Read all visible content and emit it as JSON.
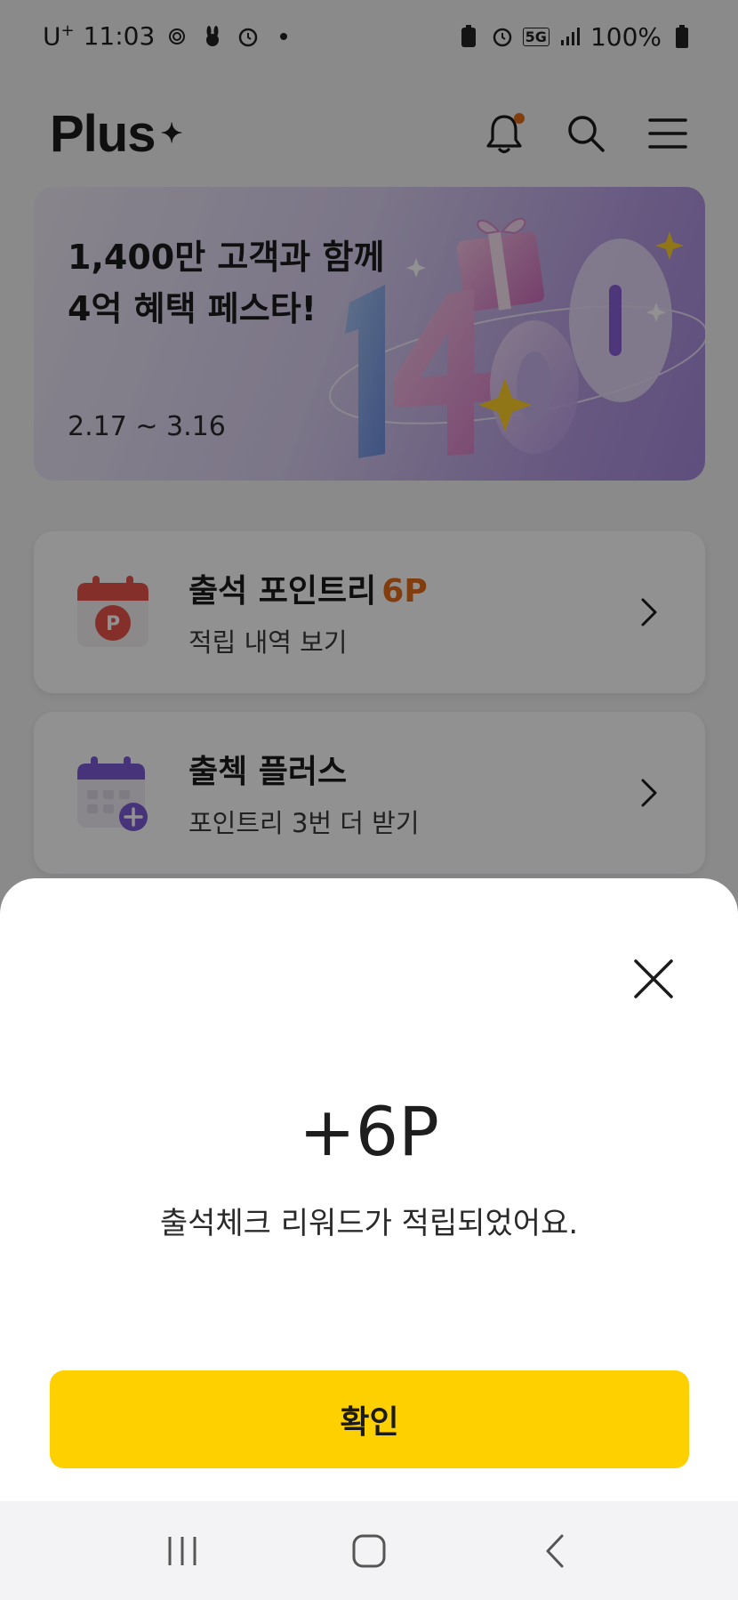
{
  "status_bar": {
    "carrier": "U",
    "carrier_sup": "+",
    "time": "11:03",
    "network": "5G",
    "battery": "100%"
  },
  "header": {
    "logo": "Plus",
    "icons": [
      "bell-icon",
      "search-icon",
      "menu-icon"
    ],
    "notification_dot_color": "#e46c1b"
  },
  "banner": {
    "title_line1": "1,400만 고객과 함께",
    "title_line2": "4억 혜택 페스타!",
    "date": "2.17 ~ 3.16",
    "art_text": "1400"
  },
  "cards": [
    {
      "title": "출석 포인트리",
      "accent": "6P",
      "subtitle": "적립 내역 보기",
      "icon": "calendar-point-icon",
      "icon_letter": "P"
    },
    {
      "title": "출첵 플러스",
      "subtitle": "포인트리 3번 더 받기",
      "icon": "calendar-plus-icon"
    }
  ],
  "sheet": {
    "points": "+6P",
    "message": "출석체크 리워드가 적립되었어요.",
    "confirm_label": "확인"
  },
  "colors": {
    "accent_orange": "#e46c1b",
    "confirm_yellow": "#ffd000",
    "purple": "#7b5ad6"
  }
}
